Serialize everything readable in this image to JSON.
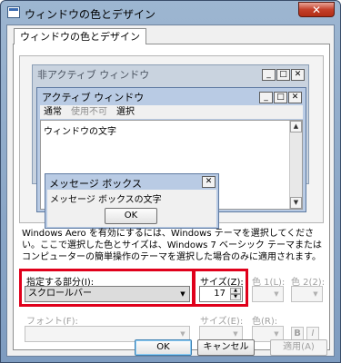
{
  "window": {
    "title": "ウィンドウの色とデザイン",
    "close_glyph": "✕"
  },
  "tab": {
    "label": "ウィンドウの色とデザイン"
  },
  "preview": {
    "inactive_title": "非アクティブ ウィンドウ",
    "active_title": "アクティブ ウィンドウ",
    "caption_buttons": [
      "_",
      "□",
      "✕"
    ],
    "menu": {
      "normal": "通常",
      "disabled": "使用不可",
      "selected": "選択"
    },
    "window_text": "ウィンドウの文字",
    "msgbox": {
      "title": "メッセージ ボックス",
      "close": "✕",
      "text": "メッセージ ボックスの文字",
      "ok": "OK"
    }
  },
  "description": "Windows Aero を有効にするには、Windows テーマを選択してください。ここで選択した色とサイズは、Windows 7 ベーシック テーマまたはコンピューターの簡単操作のテーマを選択した場合のみに適用されます。",
  "form": {
    "item_label": "指定する部分(I):",
    "item_value": "スクロールバー",
    "size_label": "サイズ(Z):",
    "size_value": "17",
    "color1_label": "色 1(L):",
    "color2_label": "色 2(2):",
    "font_label": "フォント(F):",
    "font_size_label": "サイズ(E):",
    "font_color_label": "色(R):",
    "bold": "B",
    "italic": "I"
  },
  "buttons": {
    "ok": "OK",
    "cancel": "キャンセル",
    "apply": "適用(A)"
  },
  "colors": {
    "highlight": "#e0001b",
    "title_gradient": "#9db6d1"
  }
}
